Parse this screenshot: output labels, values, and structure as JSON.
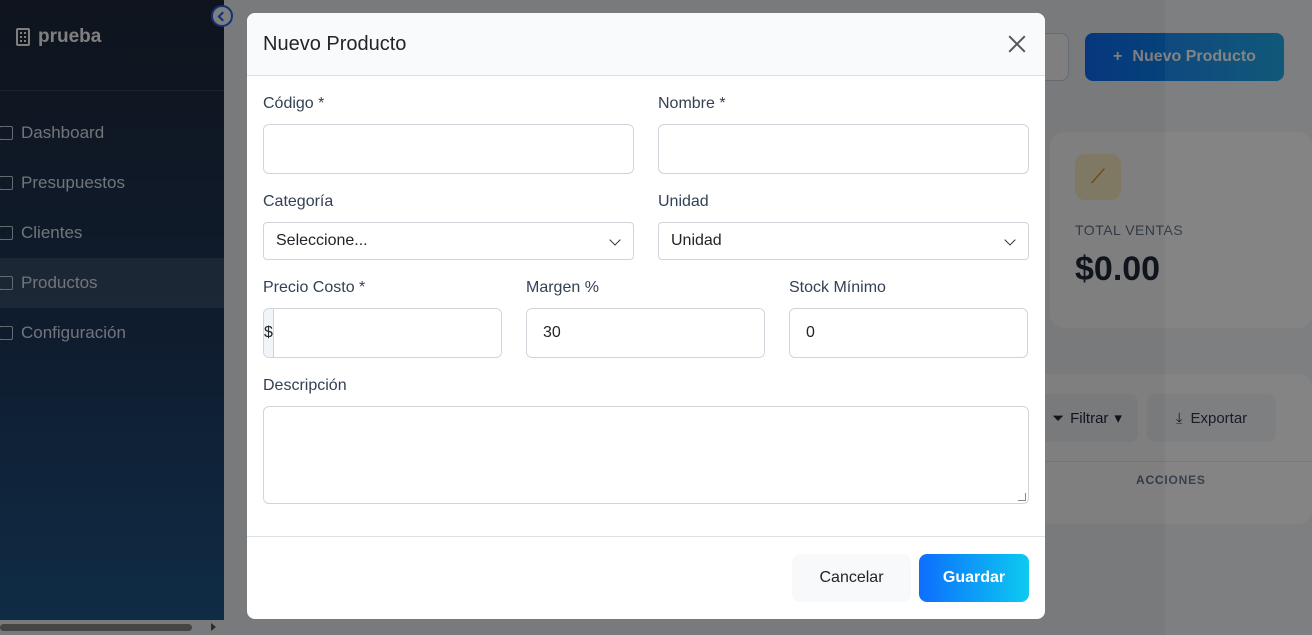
{
  "app": {
    "brand": "prueba"
  },
  "sidebar": {
    "items": [
      {
        "label": "Dashboard",
        "icon": "home-icon"
      },
      {
        "label": "Presupuestos",
        "icon": "document-icon"
      },
      {
        "label": "Clientes",
        "icon": "users-icon"
      },
      {
        "label": "Productos",
        "icon": "box-icon",
        "active": true
      },
      {
        "label": "Configuración",
        "icon": "gear-icon"
      }
    ]
  },
  "background": {
    "new_product_button": "Nuevo Producto",
    "stat_label": "TOTAL VENTAS",
    "stat_value": "$0.00",
    "filter_label": "Filtrar",
    "export_label": "Exportar",
    "column_actions": "ACCIONES"
  },
  "modal": {
    "title": "Nuevo Producto",
    "fields": {
      "codigo": {
        "label": "Código *",
        "value": ""
      },
      "nombre": {
        "label": "Nombre *",
        "value": ""
      },
      "categoria": {
        "label": "Categoría",
        "value": "Seleccione..."
      },
      "unidad": {
        "label": "Unidad",
        "value": "Unidad"
      },
      "precio_costo": {
        "label": "Precio Costo *",
        "prefix": "$",
        "value": ""
      },
      "margen": {
        "label": "Margen %",
        "value": "30",
        "suffix": "%"
      },
      "stock_minimo": {
        "label": "Stock Mínimo",
        "value": "0"
      },
      "descripcion": {
        "label": "Descripción",
        "value": ""
      }
    },
    "buttons": {
      "cancel": "Cancelar",
      "save": "Guardar"
    }
  },
  "colors": {
    "primary": "#0d6efd",
    "accent": "#0dcaf0",
    "sidebar": "#1e3a5f"
  }
}
